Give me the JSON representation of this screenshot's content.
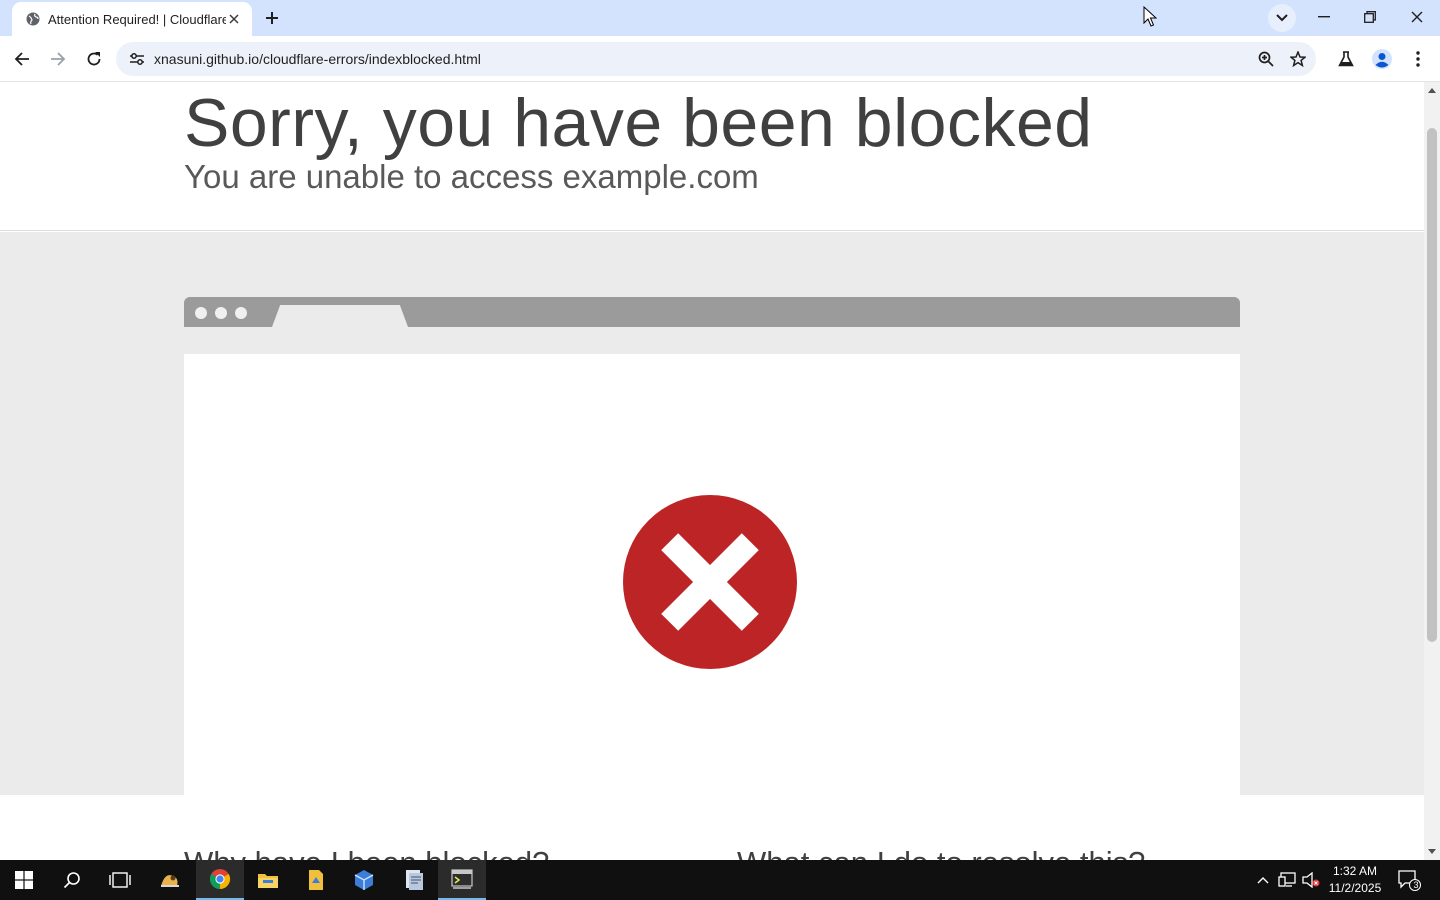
{
  "browser": {
    "tab_title": "Attention Required! | Cloudflare",
    "url": "xnasuni.github.io/cloudflare-errors/indexblocked.html"
  },
  "page": {
    "heading": "Sorry, you have been blocked",
    "subheading": "You are unable to access example.com",
    "question_left": "Why have I been blocked?",
    "question_right": "What can I do to resolve this?",
    "colors": {
      "error_red": "#bd2426",
      "mock_bar": "#9b9b9b",
      "gray_bg": "#ebebeb"
    }
  },
  "taskbar": {
    "items": [
      "start-icon",
      "search-icon",
      "task-view-icon",
      "app-icon",
      "chrome-icon",
      "file-explorer-icon",
      "files-icon",
      "virtualbox-icon",
      "document-app-icon",
      "terminal-icon"
    ],
    "time": "1:32 AM",
    "date": "11/2/2025",
    "notification_count": "3"
  }
}
